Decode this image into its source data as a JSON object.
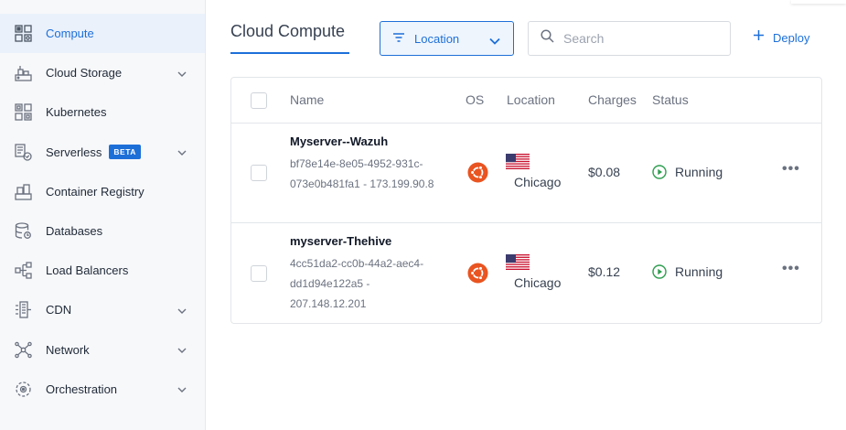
{
  "sidebar": {
    "items": [
      {
        "label": "Compute",
        "icon": "compute-icon",
        "active": true
      },
      {
        "label": "Cloud Storage",
        "icon": "cloud-storage-icon",
        "expandable": true
      },
      {
        "label": "Kubernetes",
        "icon": "kubernetes-icon"
      },
      {
        "label": "Serverless",
        "icon": "serverless-icon",
        "badge": "BETA",
        "expandable": true
      },
      {
        "label": "Container Registry",
        "icon": "container-registry-icon"
      },
      {
        "label": "Databases",
        "icon": "databases-icon"
      },
      {
        "label": "Load Balancers",
        "icon": "load-balancers-icon"
      },
      {
        "label": "CDN",
        "icon": "cdn-icon",
        "expandable": true
      },
      {
        "label": "Network",
        "icon": "network-icon",
        "expandable": true
      },
      {
        "label": "Orchestration",
        "icon": "orchestration-icon",
        "expandable": true
      }
    ]
  },
  "header": {
    "title": "Cloud Compute",
    "location_filter_label": "Location",
    "search_placeholder": "Search",
    "deploy_label": "Deploy"
  },
  "table": {
    "columns": [
      "Name",
      "OS",
      "Location",
      "Charges",
      "Status"
    ],
    "rows": [
      {
        "name": "Myserver--Wazuh",
        "meta_lines": [
          "bf78e14e-8e05-4952-931c-",
          "073e0b481fa1 - 173.199.90.8"
        ],
        "os_icon": "ubuntu-icon",
        "location_flag": "us-flag-icon",
        "location": "Chicago",
        "charges": "$0.08",
        "status": "Running"
      },
      {
        "name": "myserver-Thehive",
        "meta_lines": [
          "4cc51da2-cc0b-44a2-aec4-",
          "dd1d94e122a5 -",
          "207.148.12.201"
        ],
        "os_icon": "ubuntu-icon",
        "location_flag": "us-flag-icon",
        "location": "Chicago",
        "charges": "$0.12",
        "status": "Running"
      }
    ],
    "more_glyph": "•••"
  },
  "colors": {
    "accent": "#1d6fd8",
    "ubuntu": "#e95420",
    "running": "#2e9e4f",
    "sidebar_bg": "#f7f8fa",
    "active_bg": "#eaf1fb"
  }
}
